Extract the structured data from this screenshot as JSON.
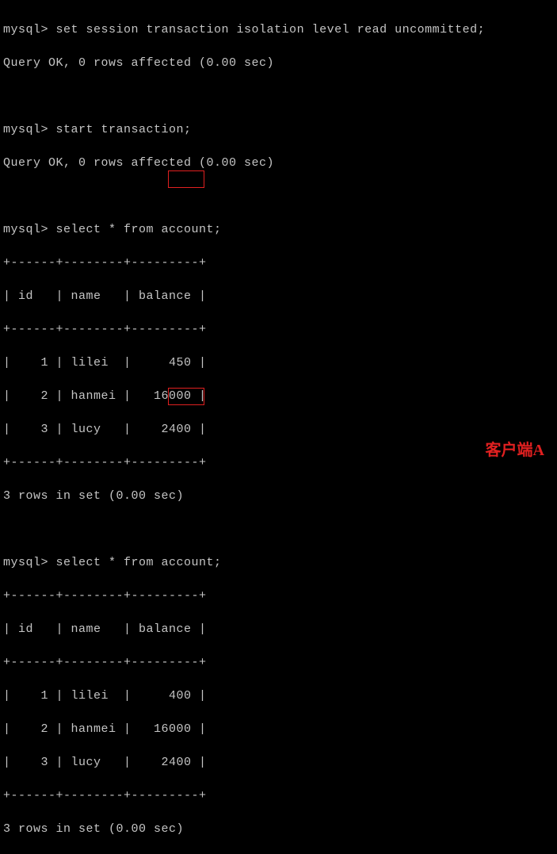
{
  "prompt": "mysql> ",
  "commands": {
    "c1": "set session transaction isolation level read uncommitted;",
    "c2": "start transaction;",
    "c3": "select * from account;",
    "c4": "select * from account;"
  },
  "responses": {
    "ok": "Query OK, 0 rows affected (0.00 sec)",
    "rows_in_set": "3 rows in set (0.00 sec)"
  },
  "table1": {
    "sep": "+------+--------+---------+",
    "header": "| id   | name   | balance |",
    "r1": "|    1 | lilei  |     450 |",
    "r2": "|    2 | hanmei |   16000 |",
    "r3": "|    3 | lucy   |    2400 |"
  },
  "table2": {
    "sep": "+------+--------+---------+",
    "header": "| id   | name   | balance |",
    "r1": "|    1 | lilei  |     400 |",
    "r2": "|    2 | hanmei |   16000 |",
    "r3": "|    3 | lucy   |    2400 |"
  },
  "chart_data": [
    {
      "type": "table",
      "title": "account (after read uncommitted)",
      "columns": [
        "id",
        "name",
        "balance"
      ],
      "rows": [
        [
          1,
          "lilei",
          450
        ],
        [
          2,
          "hanmei",
          16000
        ],
        [
          3,
          "lucy",
          2400
        ]
      ]
    },
    {
      "type": "table",
      "title": "account (re-select)",
      "columns": [
        "id",
        "name",
        "balance"
      ],
      "rows": [
        [
          1,
          "lilei",
          400
        ],
        [
          2,
          "hanmei",
          16000
        ],
        [
          3,
          "lucy",
          2400
        ]
      ]
    }
  ],
  "label": "客户端A"
}
